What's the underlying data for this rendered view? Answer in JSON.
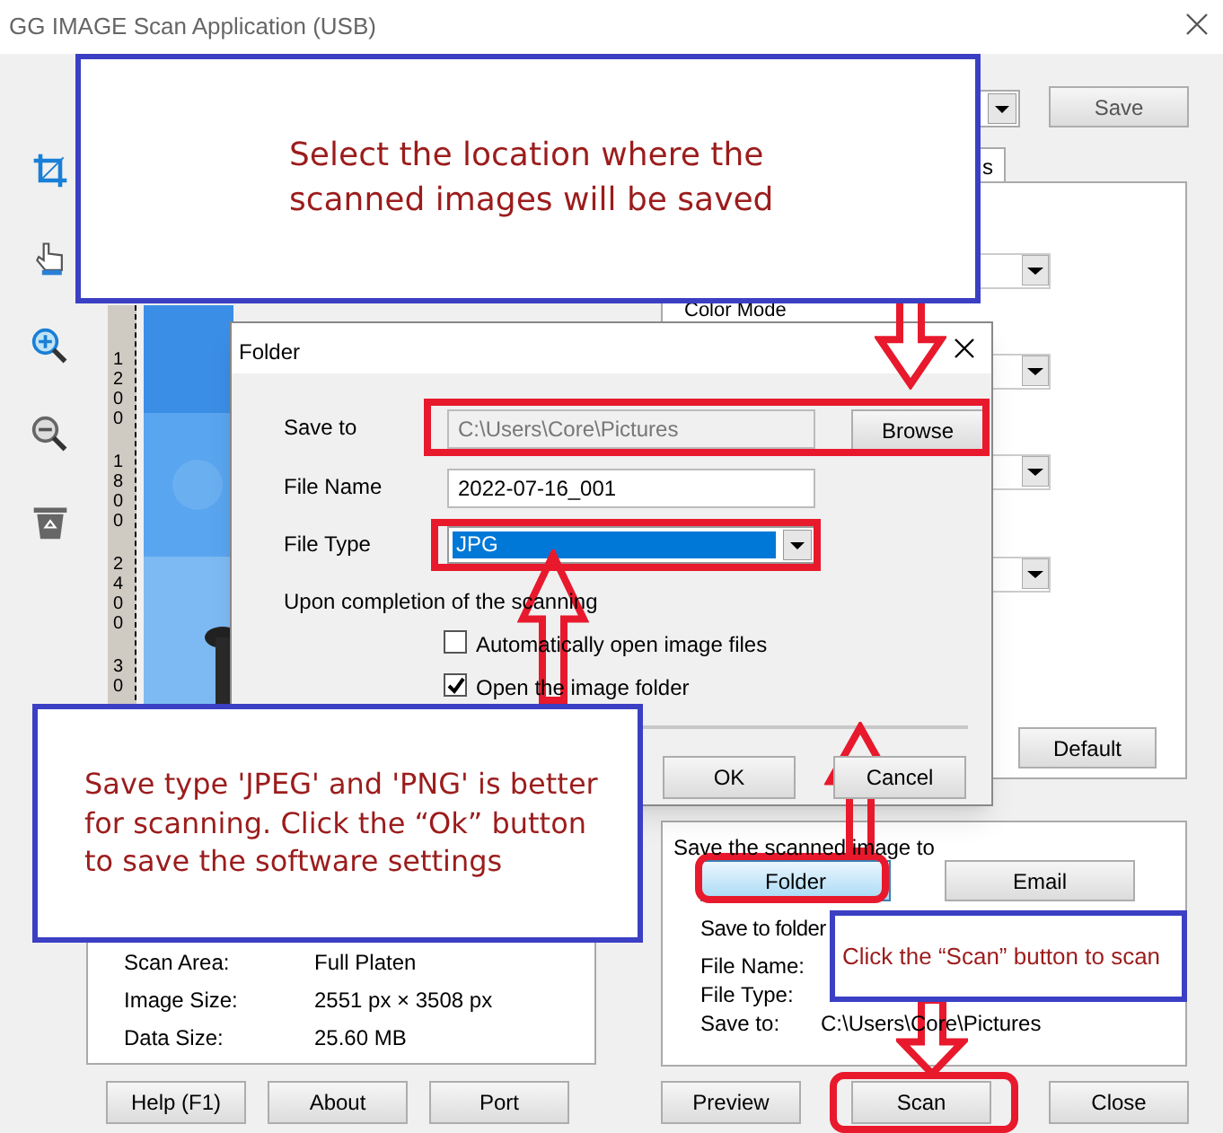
{
  "window": {
    "title": "GG IMAGE Scan Application (USB)"
  },
  "toolbar": [
    {
      "kind": "crop"
    },
    {
      "kind": "hand"
    },
    {
      "kind": "zoom_in"
    },
    {
      "kind": "zoom_out"
    },
    {
      "kind": "recycle"
    }
  ],
  "ruler_labels": [
    "1200",
    "1800",
    "2400",
    "30"
  ],
  "preview": {
    "kind": "picture"
  },
  "settings_panel": {
    "save_button": "Save",
    "tab": "s",
    "color_mode_label": "Color Mode",
    "default_button": "Default"
  },
  "folder_dialog": {
    "title": "Folder",
    "fields": [
      {
        "label": "Save to",
        "value": "C:\\Users\\Core\\Pictures",
        "disabled": true
      },
      {
        "label": "File Name",
        "value": "2022-07-16_001",
        "disabled": false
      }
    ],
    "browse_button": "Browse",
    "file_type": {
      "label": "File Type",
      "value": "JPG"
    },
    "completion_label": "Upon completion of the scanning",
    "options": [
      {
        "label": "Automatically open image files",
        "checked": false
      },
      {
        "label": "Open the image folder",
        "checked": true
      }
    ],
    "buttons": [
      "OK",
      "Cancel"
    ]
  },
  "info_panel": [
    {
      "label": "Scan Area:",
      "value": "Full Platen"
    },
    {
      "label": "Image Size:",
      "value": "2551 px × 3508 px"
    },
    {
      "label": "Data Size:",
      "value": "25.60 MB"
    }
  ],
  "left_buttons": [
    "Help (F1)",
    "About",
    "Port"
  ],
  "save_panel": {
    "title": "Save the scanned image to",
    "destinations": [
      {
        "label": "Folder",
        "selected": true
      },
      {
        "label": "Email",
        "selected": false
      }
    ],
    "subtitle": "Save to folder",
    "rows": [
      {
        "label": "File Name:"
      },
      {
        "label": "File Type:"
      },
      {
        "label": "Save to:",
        "value": "C:\\Users\\Core\\Pictures"
      }
    ]
  },
  "bottom_buttons": [
    "Preview",
    "Scan",
    "Close"
  ],
  "annotations": [
    {
      "text": "Select the location where the scanned images will be saved"
    },
    {
      "text": "Save type 'JPEG' and 'PNG' is better for scanning. Click the “Ok” button to save the software settings"
    },
    {
      "text": "Click the “Scan” button to scan"
    }
  ]
}
